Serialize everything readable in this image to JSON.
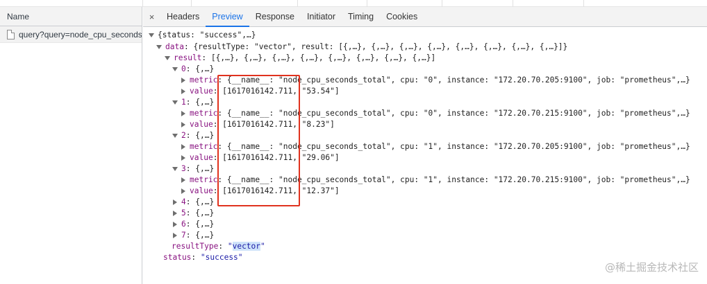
{
  "left_pane": {
    "header": "Name",
    "request": "query?query=node_cpu_seconds_total"
  },
  "tabs": {
    "close": "×",
    "items": [
      "Headers",
      "Preview",
      "Response",
      "Initiator",
      "Timing",
      "Cookies"
    ],
    "active": "Preview"
  },
  "tree": {
    "root": "{status: \"success\",…}",
    "data_key": "data",
    "data_summary": "{resultType: \"vector\", result: [{,…}, {,…}, {,…}, {,…}, {,…}, {,…}, {,…}, {,…}]}",
    "result_key": "result",
    "result_summary": "[{,…}, {,…}, {,…}, {,…}, {,…}, {,…}, {,…}, {,…}]",
    "items": [
      {
        "index": "0",
        "summary": "{,…}",
        "metric": "{__name__: \"node_cpu_seconds_total\", cpu: \"0\", instance: \"172.20.70.205:9100\", job: \"prometheus\",…}",
        "value": "[1617016142.711, \"53.54\"]"
      },
      {
        "index": "1",
        "summary": "{,…}",
        "metric": "{__name__: \"node_cpu_seconds_total\", cpu: \"0\", instance: \"172.20.70.215:9100\", job: \"prometheus\",…}",
        "value": "[1617016142.711, \"8.23\"]"
      },
      {
        "index": "2",
        "summary": "{,…}",
        "metric": "{__name__: \"node_cpu_seconds_total\", cpu: \"1\", instance: \"172.20.70.205:9100\", job: \"prometheus\",…}",
        "value": "[1617016142.711, \"29.06\"]"
      },
      {
        "index": "3",
        "summary": "{,…}",
        "metric": "{__name__: \"node_cpu_seconds_total\", cpu: \"1\", instance: \"172.20.70.215:9100\", job: \"prometheus\",…}",
        "value": "[1617016142.711, \"12.37\"]"
      }
    ],
    "collapsed": [
      {
        "index": "4",
        "summary": "{,…}"
      },
      {
        "index": "5",
        "summary": "{,…}"
      },
      {
        "index": "6",
        "summary": "{,…}"
      },
      {
        "index": "7",
        "summary": "{,…}"
      }
    ],
    "metric_key": "metric",
    "value_key": "value",
    "resultType_key": "resultType",
    "resultType_value": "vector",
    "status_key": "status",
    "status_value": "\"success\""
  },
  "watermark": "@稀土掘金技术社区",
  "colors": {
    "highlight_box": "#e0321e",
    "active_tab": "#1a73e8",
    "key": "#881280",
    "string": "#1a1aa6"
  }
}
